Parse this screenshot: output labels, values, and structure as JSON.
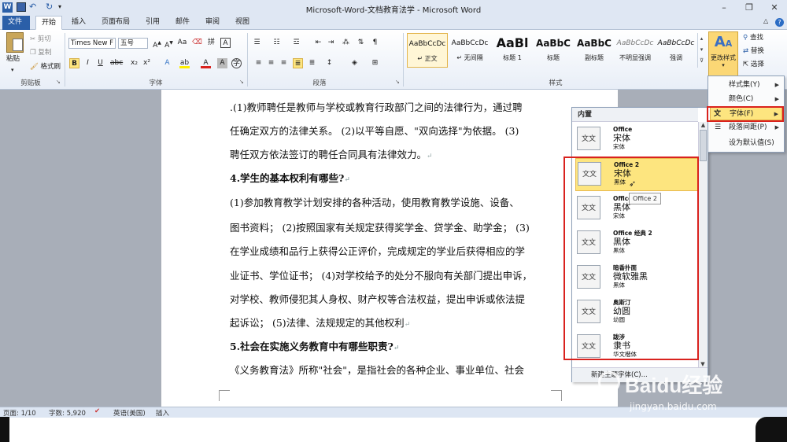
{
  "window": {
    "title": "Microsoft-Word-文档教育法学 - Microsoft Word",
    "controls": [
      "–",
      "❐",
      "✕"
    ]
  },
  "tabs": [
    "文件",
    "开始",
    "插入",
    "页面布局",
    "引用",
    "邮件",
    "审阅",
    "视图"
  ],
  "clipboard": {
    "paste": "粘贴",
    "cut": "剪切",
    "copy": "复制",
    "format_painter": "格式刷",
    "label": "剪贴板"
  },
  "font_group": {
    "font_name": "Times New F",
    "font_size": "五号",
    "label": "字体"
  },
  "paragraph_group": {
    "label": "段落"
  },
  "styles_group": {
    "label": "样式",
    "items": [
      {
        "preview": "AaBbCcDc",
        "name": "↵ 正文"
      },
      {
        "preview": "AaBbCcDc",
        "name": "↵ 无间隔"
      },
      {
        "preview": "AaBl",
        "name": "标题 1"
      },
      {
        "preview": "AaBbC",
        "name": "标题"
      },
      {
        "preview": "AaBbC",
        "name": "副标题"
      },
      {
        "preview": "AaBbCcDc",
        "name": "不明显强调"
      },
      {
        "preview": "AaBbCcDc",
        "name": "强调"
      }
    ],
    "change_styles": "更改样式"
  },
  "editing_group": {
    "find": "查找",
    "replace": "替换",
    "select": "选择"
  },
  "document": {
    "lines": [
      ".(1)教师聘任是教师与学校或教育行政部门之间的法律行为，通过聘",
      "任确定双方的法律关系。 (2)以平等自愿、\"双向选择\"为依据。 (3)",
      "聘任双方依法签订的聘任合同具有法律效力。",
      "4.学生的基本权利有哪些?",
      "(1)参加教育教学计划安排的各种活动，使用教育教学设施、设备、",
      "图书资料； (2)按照国家有关规定获得奖学金、贷学金、助学金； (3)",
      "在学业成绩和品行上获得公正评价，完成规定的学业后获得相应的学",
      "业证书、学位证书； (4)对学校给予的处分不服向有关部门提出申诉，",
      "对学校、教师侵犯其人身权、财产权等合法权益，提出申诉或依法提",
      "起诉讼； (5)法律、法规规定的其他权利",
      "5.社会在实施义务教育中有哪些职责?",
      "《义务教育法》所称\"社会\"，是指社会的各种企业、事业单位、社会"
    ]
  },
  "font_gallery": {
    "header": "内置",
    "items": [
      {
        "icon": "文文",
        "theme": "Office",
        "heading": "宋体",
        "body": "宋体"
      },
      {
        "icon": "文文",
        "theme": "Office 2",
        "heading": "宋体",
        "body": "黑体"
      },
      {
        "icon": "文文",
        "theme": "Office",
        "heading": "黑体",
        "body": "宋体"
      },
      {
        "icon": "文文",
        "theme": "Office 经典 2",
        "heading": "黑体",
        "body": "黑体"
      },
      {
        "icon": "文文",
        "theme": "暗香扑面",
        "heading": "微软雅黑",
        "body": "黑体"
      },
      {
        "icon": "文文",
        "theme": "奥斯汀",
        "heading": "幼圆",
        "body": "幼圆"
      },
      {
        "icon": "文文",
        "theme": "跋涉",
        "heading": "隶书",
        "body": "华文楷体"
      }
    ],
    "tooltip": "Office 2",
    "footer": "新建主题字体(C)..."
  },
  "change_styles_menu": {
    "items": [
      "样式集(Y)",
      "颜色(C)",
      "字体(F)",
      "段落间距(P)",
      "设为默认值(S)"
    ]
  },
  "statusbar": {
    "page": "页面: 1/10",
    "words": "字数: 5,920",
    "lang": "英语(美国)",
    "insert": "插入"
  },
  "watermark": {
    "brand": "Baidu经验",
    "url": "jingyan.baidu.com"
  },
  "colors": {
    "file_tab": "#2b5fa8",
    "highlight": "#fde57f",
    "red": "#d9221e"
  }
}
